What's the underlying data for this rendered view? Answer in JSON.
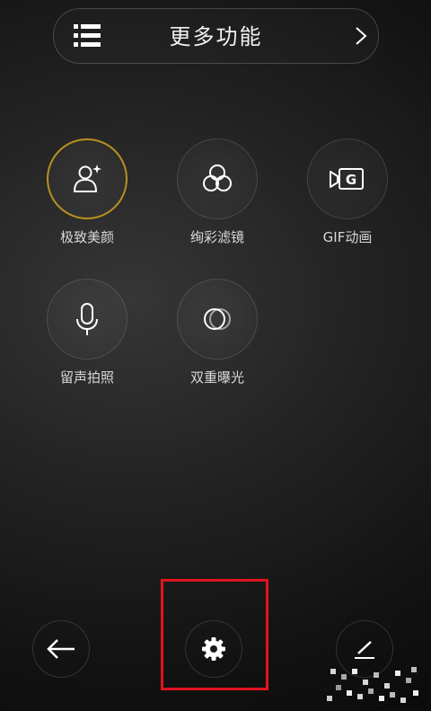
{
  "header": {
    "title": "更多功能",
    "icons": {
      "left": "list-icon",
      "right": "chevron-right-icon"
    }
  },
  "modes": [
    {
      "label": "极致美颜",
      "icon": "beauty-face-icon",
      "active": true
    },
    {
      "label": "绚彩滤镜",
      "icon": "filter-icon",
      "active": false
    },
    {
      "label": "GIF动画",
      "icon": "gif-camera-icon",
      "active": false
    },
    {
      "label": "留声拍照",
      "icon": "microphone-icon",
      "active": false
    },
    {
      "label": "双重曝光",
      "icon": "double-exposure-icon",
      "active": false
    }
  ],
  "bottom_bar": {
    "icons": [
      "back-arrow-icon",
      "settings-gear-icon",
      "edit-pen-icon"
    ]
  },
  "colors": {
    "active_ring": "#b8901f",
    "highlight_box": "#e0141e"
  }
}
